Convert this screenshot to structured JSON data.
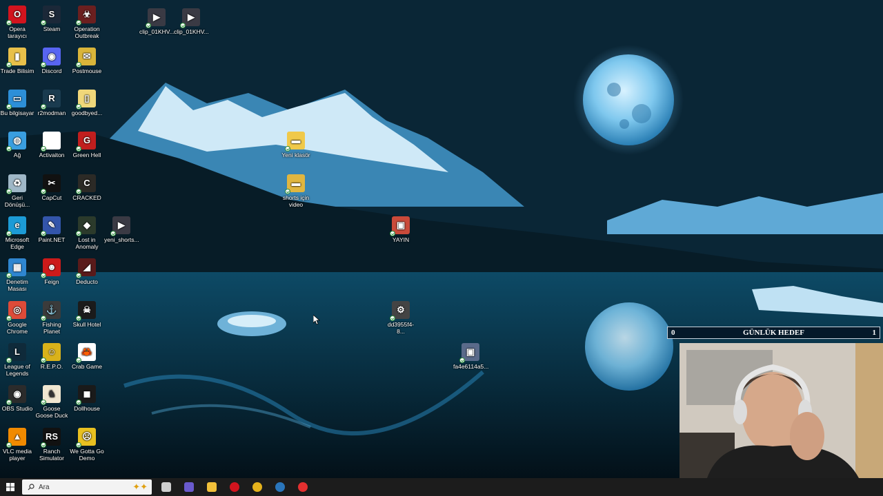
{
  "desktop": {
    "icons": [
      {
        "label": "Opera tarayıcı",
        "color": "#d2141e",
        "glyph": "O"
      },
      {
        "label": "Steam",
        "color": "#1b2838",
        "glyph": "S"
      },
      {
        "label": "Operation Outbreak",
        "color": "#6b1f1f",
        "glyph": "☣"
      },
      {
        "label": "clip_01KHV...",
        "color": "#3a3a44",
        "glyph": "▶"
      },
      {
        "label": "clip_01KHV...",
        "color": "#3a3a44",
        "glyph": "▶"
      },
      {
        "label": "Trade Bilisim",
        "color": "#e8c04a",
        "glyph": "▮"
      },
      {
        "label": "Discord",
        "color": "#5865f2",
        "glyph": "◉"
      },
      {
        "label": "Postmouse",
        "color": "#d9b53a",
        "glyph": "✉"
      },
      {
        "label": "Bu bilgisayar",
        "color": "#2d8fd8",
        "glyph": "▭"
      },
      {
        "label": "r2modman",
        "color": "#1a3b4f",
        "glyph": "R"
      },
      {
        "label": "goodbyed...",
        "color": "#f0d77a",
        "glyph": "▯"
      },
      {
        "label": "Ağ",
        "color": "#3a9ee0",
        "glyph": "◍"
      },
      {
        "label": "Activaiton",
        "color": "#ffffff",
        "glyph": ""
      },
      {
        "label": "Green Hell",
        "color": "#c11e1e",
        "glyph": "G"
      },
      {
        "label": "Yeni klasör",
        "color": "#f0c94a",
        "glyph": "▬"
      },
      {
        "label": "Geri Dönüşü...",
        "color": "#9fb7c7",
        "glyph": "♻"
      },
      {
        "label": "CapCut",
        "color": "#111111",
        "glyph": "✂"
      },
      {
        "label": "CRACKED",
        "color": "#2c2a26",
        "glyph": "C"
      },
      {
        "label": "shorts için video",
        "color": "#e0b640",
        "glyph": "▬"
      },
      {
        "label": "Microsoft Edge",
        "color": "#1c9bd6",
        "glyph": "e"
      },
      {
        "label": "Paint.NET",
        "color": "#3355aa",
        "glyph": "✎"
      },
      {
        "label": "Lost in Anomaly",
        "color": "#2b3a2b",
        "glyph": "◆"
      },
      {
        "label": "yeni_shorts...",
        "color": "#3a3a44",
        "glyph": "▶"
      },
      {
        "label": "YAYIN",
        "color": "#c94a3a",
        "glyph": "▣"
      },
      {
        "label": "Denetim Masası",
        "color": "#2f86d0",
        "glyph": "▦"
      },
      {
        "label": "Feign",
        "color": "#cc1a1a",
        "glyph": "☻"
      },
      {
        "label": "Deducto",
        "color": "#5a1a1a",
        "glyph": "◢"
      },
      {
        "label": "Google Chrome",
        "color": "#dd4b39",
        "glyph": "◎"
      },
      {
        "label": "Fishing Planet",
        "color": "#3b3b3b",
        "glyph": "⚓"
      },
      {
        "label": "Skull Hotel",
        "color": "#1b1b1b",
        "glyph": "☠"
      },
      {
        "label": "dd3955f4-8...",
        "color": "#444444",
        "glyph": "⚙"
      },
      {
        "label": "League of Legends",
        "color": "#0f2a3a",
        "glyph": "L"
      },
      {
        "label": "R.E.P.O.",
        "color": "#d9b21a",
        "glyph": "☺"
      },
      {
        "label": "Crab Game",
        "color": "#ffffff",
        "glyph": "🦀"
      },
      {
        "label": "fa4e6114a5...",
        "color": "#5a6a8a",
        "glyph": "▣"
      },
      {
        "label": "OBS Studio",
        "color": "#2b2b2b",
        "glyph": "◉"
      },
      {
        "label": "Goose Goose Duck",
        "color": "#f0e6d0",
        "glyph": "♞"
      },
      {
        "label": "Dollhouse",
        "color": "#1a1a1a",
        "glyph": "◼"
      },
      {
        "label": "VLC media player",
        "color": "#f08a00",
        "glyph": "▲"
      },
      {
        "label": "Ranch Simulator",
        "color": "#111111",
        "glyph": "RS"
      },
      {
        "label": "We Gotta Go Demo",
        "color": "#e8c020",
        "glyph": "☹"
      }
    ]
  },
  "overlay": {
    "goal_left": "0",
    "goal_title": "GÜNLÜK HEDEF",
    "goal_right": "1"
  },
  "taskbar": {
    "search_placeholder": "Ara",
    "apps": [
      {
        "name": "task-view",
        "color": "#cfcfcf"
      },
      {
        "name": "copilot",
        "color": "#6a5acd"
      },
      {
        "name": "file-explorer",
        "color": "#f2c03a"
      },
      {
        "name": "opera",
        "color": "#d2141e"
      },
      {
        "name": "chrome",
        "color": "#e5b21c"
      },
      {
        "name": "steam",
        "color": "#2a75bb"
      },
      {
        "name": "obs",
        "color": "#e43030"
      }
    ]
  }
}
